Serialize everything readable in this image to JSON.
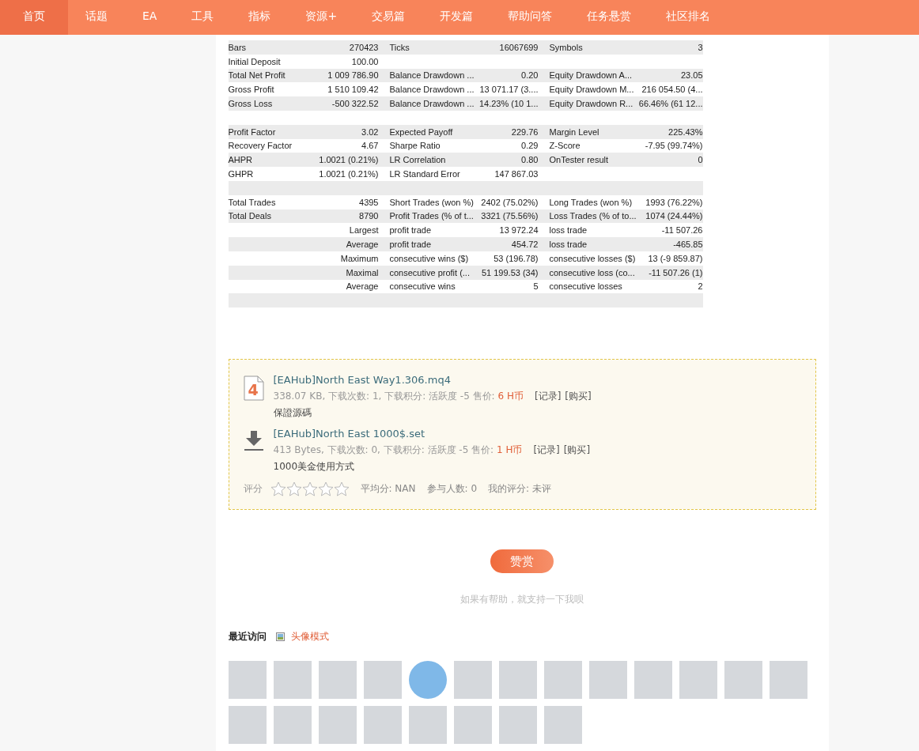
{
  "nav": [
    {
      "label": "首页",
      "selected": true
    },
    {
      "label": "话题",
      "selected": false
    },
    {
      "label": "EA",
      "selected": false
    },
    {
      "label": "工具",
      "selected": false
    },
    {
      "label": "指标",
      "selected": false
    },
    {
      "label": "资源+",
      "selected": false
    },
    {
      "label": "交易篇",
      "selected": false
    },
    {
      "label": "开发篇",
      "selected": false
    },
    {
      "label": "帮助问答",
      "selected": false
    },
    {
      "label": "任务悬赏",
      "selected": false
    },
    {
      "label": "社区排名",
      "selected": false
    }
  ],
  "report": {
    "rows": [
      {
        "kind": "summary",
        "cells": [
          "Bars",
          "270423",
          "Ticks",
          "16067699",
          "Symbols",
          "3"
        ]
      },
      {
        "kind": "summary",
        "cells": [
          "Initial Deposit",
          "100.00",
          "",
          "",
          "",
          ""
        ]
      },
      {
        "kind": "summary",
        "cells": [
          "Total Net Profit",
          "1 009 786.90",
          "Balance Drawdown ...",
          "0.20",
          "Equity Drawdown A...",
          "23.05"
        ]
      },
      {
        "kind": "summary",
        "cells": [
          "Gross Profit",
          "1 510 109.42",
          "Balance Drawdown ...",
          "13 071.17 (3....",
          "Equity Drawdown M...",
          "216 054.50 (4..."
        ]
      },
      {
        "kind": "summary",
        "cells": [
          "Gross Loss",
          "-500 322.52",
          "Balance Drawdown ...",
          "14.23% (10 1...",
          "Equity Drawdown R...",
          "66.46% (61 12..."
        ]
      },
      {
        "kind": "blank",
        "cells": []
      },
      {
        "kind": "summary",
        "cells": [
          "Profit Factor",
          "3.02",
          "Expected Payoff",
          "229.76",
          "Margin Level",
          "225.43%"
        ]
      },
      {
        "kind": "summary",
        "cells": [
          "Recovery Factor",
          "4.67",
          "Sharpe Ratio",
          "0.29",
          "Z-Score",
          "-7.95 (99.74%)"
        ]
      },
      {
        "kind": "summary",
        "cells": [
          "AHPR",
          "1.0021 (0.21%)",
          "LR Correlation",
          "0.80",
          "OnTester result",
          "0"
        ]
      },
      {
        "kind": "summary",
        "cells": [
          "GHPR",
          "1.0021 (0.21%)",
          "LR Standard Error",
          "147 867.03",
          "",
          ""
        ]
      },
      {
        "kind": "blank",
        "cells": []
      },
      {
        "kind": "summary",
        "cells": [
          "Total Trades",
          "4395",
          "Short Trades (won %)",
          "2402 (75.02%)",
          "Long Trades (won %)",
          "1993 (76.22%)"
        ]
      },
      {
        "kind": "summary",
        "cells": [
          "Total Deals",
          "8790",
          "Profit Trades (% of t...",
          "3321 (75.56%)",
          "Loss Trades (% of to...",
          "1074 (24.44%)"
        ]
      },
      {
        "kind": "detail",
        "cells": [
          "Largest",
          "",
          "profit trade",
          "13 972.24",
          "loss trade",
          "-11 507.26"
        ]
      },
      {
        "kind": "detail",
        "cells": [
          "Average",
          "",
          "profit trade",
          "454.72",
          "loss trade",
          "-465.85"
        ]
      },
      {
        "kind": "detail",
        "cells": [
          "Maximum",
          "",
          "consecutive wins ($)",
          "53 (196.78)",
          "consecutive losses ($)",
          "13 (-9 859.87)"
        ]
      },
      {
        "kind": "detail",
        "cells": [
          "Maximal",
          "",
          "consecutive profit (...",
          "51 199.53 (34)",
          "consecutive loss (co...",
          "-11 507.26 (1)"
        ]
      },
      {
        "kind": "detail",
        "cells": [
          "Average",
          "",
          "consecutive wins",
          "5",
          "consecutive losses",
          "2"
        ]
      },
      {
        "kind": "blank",
        "cells": []
      }
    ]
  },
  "attachments": [
    {
      "kind": "mq4",
      "title": "[EAHub]North East Way1.306.mq4",
      "meta": "338.07 KB, 下载次数: 1, 下载积分: 活跃度 -5 售价: ",
      "price": "6 H币",
      "links": [
        "[记录]",
        "[购买]"
      ],
      "description": "保證源碼",
      "icon_text": "4"
    },
    {
      "kind": "download",
      "title": "[EAHub]North East 1000$.set",
      "meta": "413 Bytes, 下载次数: 0, 下载积分: 活跃度 -5 售价: ",
      "price": "1 H币",
      "links": [
        "[记录]",
        "[购买]"
      ],
      "description": "1000美金使用方式"
    }
  ],
  "rating": {
    "label": "评分",
    "stars": 0,
    "average": "平均分: NAN",
    "participants": "参与人数: 0",
    "mine": "我的评分: 未评"
  },
  "reward": {
    "button": "赞赏",
    "hint": "如果有帮助，就支持一下我呗"
  },
  "recent": {
    "title": "最近访问",
    "mode_link": "头像模式",
    "visitors": [
      {
        "kind": "square"
      },
      {
        "kind": "square"
      },
      {
        "kind": "square"
      },
      {
        "kind": "square"
      },
      {
        "kind": "round"
      },
      {
        "kind": "square"
      },
      {
        "kind": "square"
      },
      {
        "kind": "square"
      },
      {
        "kind": "square"
      },
      {
        "kind": "square"
      },
      {
        "kind": "square"
      },
      {
        "kind": "square"
      },
      {
        "kind": "square"
      },
      {
        "kind": "square"
      },
      {
        "kind": "square"
      },
      {
        "kind": "square"
      },
      {
        "kind": "square"
      },
      {
        "kind": "square"
      },
      {
        "kind": "square"
      },
      {
        "kind": "square"
      },
      {
        "kind": "square"
      }
    ]
  }
}
